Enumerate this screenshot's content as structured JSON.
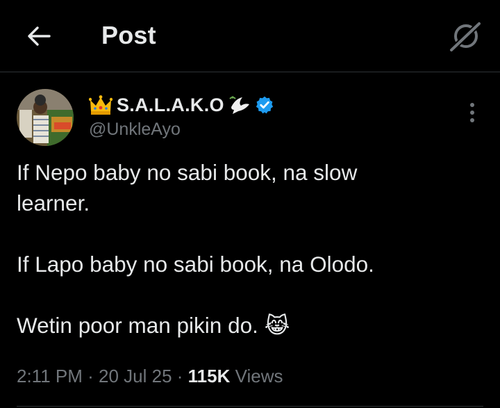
{
  "header": {
    "title": "Post",
    "back_icon": "arrow-left-icon",
    "grok_icon": "grok-icon"
  },
  "author": {
    "name": "S.A.L.A.K.O",
    "name_prefix_emoji": "crown",
    "name_suffix_emoji": "dove",
    "handle": "@UnkleAyo",
    "verified": true,
    "verified_color": "#1d9bf0"
  },
  "tweet": {
    "line1": "If Nepo baby no sabi book, na slow",
    "line2": "learner.",
    "line3": "If Lapo baby no sabi book, na Olodo.",
    "line4": "Wetin poor man pikin do. 😹"
  },
  "meta": {
    "time": "2:11 PM",
    "sep1": " · ",
    "date": "20 Jul 25",
    "sep2": " · ",
    "views_count": "115K",
    "views_label": " Views"
  },
  "colors": {
    "background": "#000000",
    "text": "#e7e9ea",
    "secondary": "#71767b",
    "border": "#2f3336"
  }
}
